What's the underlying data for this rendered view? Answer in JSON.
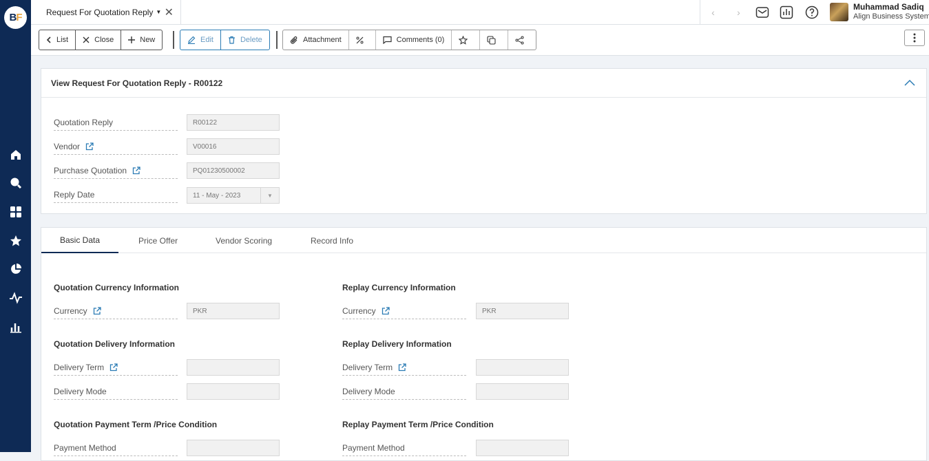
{
  "brand": {
    "logo_b": "B",
    "logo_f": "F"
  },
  "tab": {
    "title": "Request For Quotation Reply"
  },
  "user": {
    "name": "Muhammad Sadiq",
    "org": "Align Business Systems"
  },
  "toolbar": {
    "list": "List",
    "close": "Close",
    "new": "New",
    "edit": "Edit",
    "delete": "Delete",
    "attachment": "Attachment",
    "comments": "Comments (0)"
  },
  "header": {
    "title": "View Request For Quotation Reply - R00122",
    "fields": [
      {
        "label": "Quotation Reply",
        "value": "R00122"
      },
      {
        "label": "Vendor",
        "value": "V00016"
      },
      {
        "label": "Purchase Quotation",
        "value": "PQ01230500002"
      },
      {
        "label": "Reply Date",
        "value": "11 - May - 2023"
      }
    ]
  },
  "tabs": [
    "Basic Data",
    "Price Offer",
    "Vendor Scoring",
    "Record Info"
  ],
  "basic": {
    "q_currency_title": "Quotation Currency Information",
    "r_currency_title": "Replay Currency Information",
    "currency_label": "Currency",
    "q_currency": "PKR",
    "r_currency": "PKR",
    "q_delivery_title": "Quotation Delivery Information",
    "r_delivery_title": "Replay Delivery Information",
    "delivery_term_label": "Delivery Term",
    "delivery_mode_label": "Delivery Mode",
    "q_payment_title": "Quotation Payment Term /Price Condition",
    "r_payment_title": "Replay Payment Term /Price Condition",
    "payment_method_label": "Payment Method"
  },
  "colors": {
    "rail": "#0e2a55",
    "accent": "#2a7bb4"
  }
}
